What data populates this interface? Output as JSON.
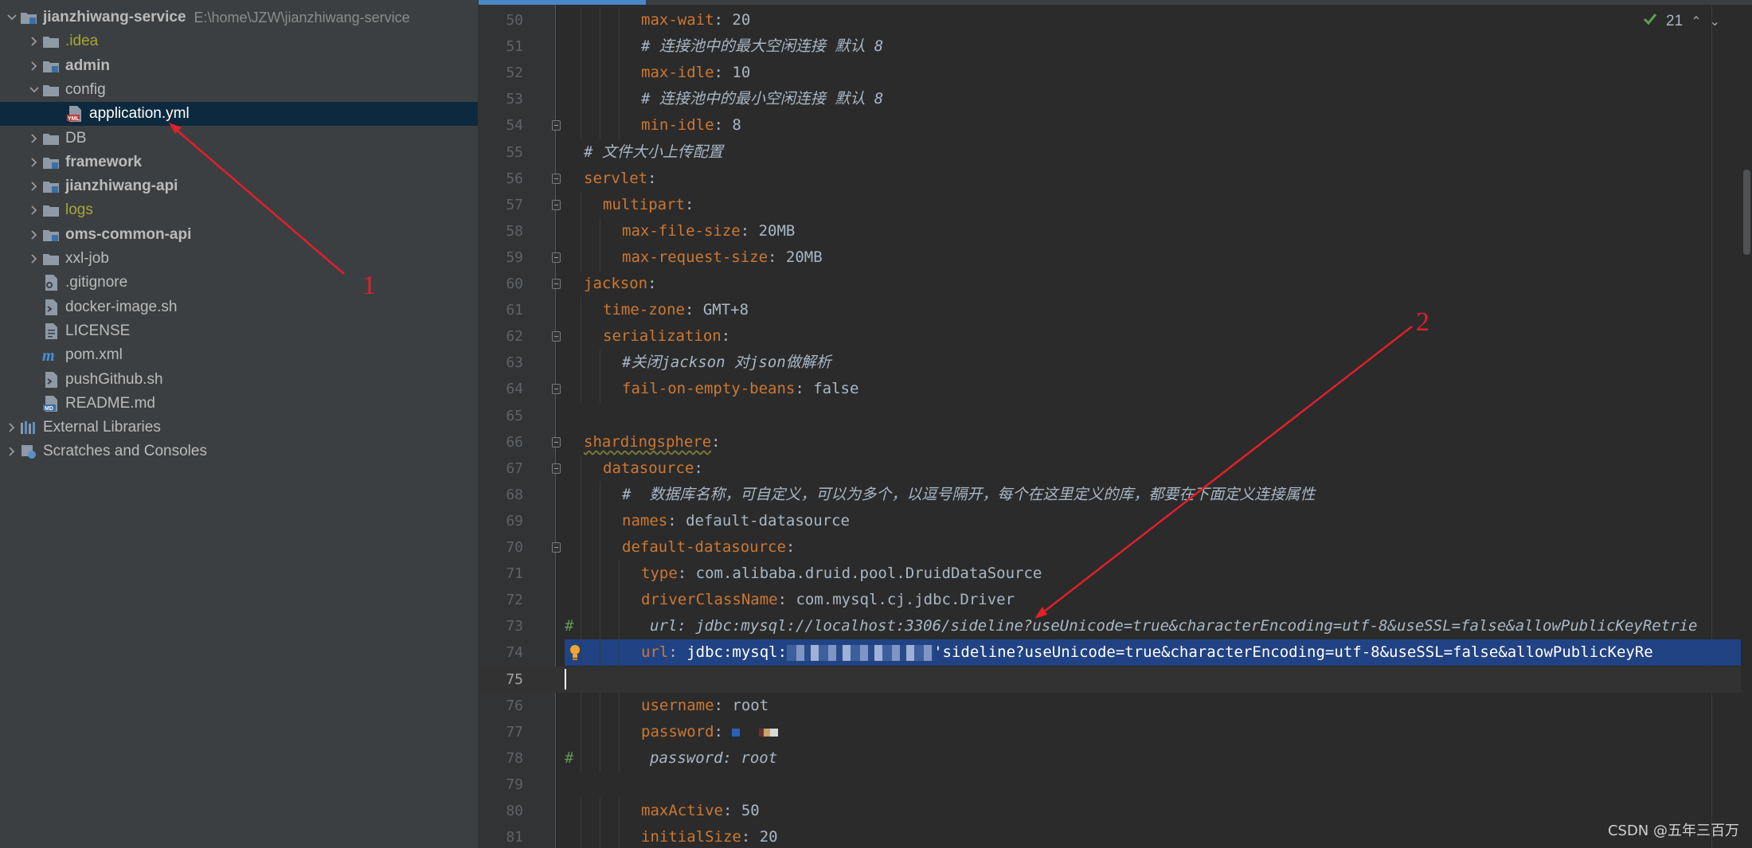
{
  "project_tree": {
    "root": {
      "name": "jianzhiwang-service",
      "path": "E:\\home\\JZW\\jianzhiwang-service"
    },
    "items": [
      {
        "label": ".idea",
        "icon": "folder-icon",
        "style": "yellow",
        "expandable": true
      },
      {
        "label": "admin",
        "icon": "module-folder-icon",
        "style": "bold",
        "expandable": true
      },
      {
        "label": "config",
        "icon": "folder-icon",
        "style": "normal",
        "expandable": true,
        "expanded": true
      },
      {
        "label": "application.yml",
        "icon": "yml-file-icon",
        "style": "normal",
        "expandable": false,
        "selected": true,
        "child": true
      },
      {
        "label": "DB",
        "icon": "folder-icon",
        "style": "normal",
        "expandable": true
      },
      {
        "label": "framework",
        "icon": "module-folder-icon",
        "style": "bold",
        "expandable": true
      },
      {
        "label": "jianzhiwang-api",
        "icon": "module-folder-icon",
        "style": "bold",
        "expandable": true
      },
      {
        "label": "logs",
        "icon": "folder-icon",
        "style": "yellow",
        "expandable": true
      },
      {
        "label": "oms-common-api",
        "icon": "module-folder-icon",
        "style": "bold",
        "expandable": true
      },
      {
        "label": "xxl-job",
        "icon": "folder-icon",
        "style": "normal",
        "expandable": true
      },
      {
        "label": ".gitignore",
        "icon": "gitignore-file-icon",
        "style": "normal",
        "expandable": false
      },
      {
        "label": "docker-image.sh",
        "icon": "shell-file-icon",
        "style": "normal",
        "expandable": false
      },
      {
        "label": "LICENSE",
        "icon": "text-file-icon",
        "style": "normal",
        "expandable": false
      },
      {
        "label": "pom.xml",
        "icon": "maven-file-icon",
        "style": "normal",
        "expandable": false
      },
      {
        "label": "pushGithub.sh",
        "icon": "shell-file-icon",
        "style": "normal",
        "expandable": false
      },
      {
        "label": "README.md",
        "icon": "markdown-file-icon",
        "style": "normal",
        "expandable": false
      }
    ],
    "external_libraries": "External Libraries",
    "scratches": "Scratches and Consoles"
  },
  "editor": {
    "inspection_count": "21",
    "lines": [
      {
        "n": "50",
        "indent": 4,
        "key": "max-wait",
        "value": "20",
        "fold": false
      },
      {
        "n": "51",
        "indent": 4,
        "comment": "# 连接池中的最大空闲连接 默认 8"
      },
      {
        "n": "52",
        "indent": 4,
        "key": "max-idle",
        "value": "10"
      },
      {
        "n": "53",
        "indent": 4,
        "comment": "# 连接池中的最小空闲连接 默认 8"
      },
      {
        "n": "54",
        "indent": 4,
        "key": "min-idle",
        "value": "8",
        "fold": true
      },
      {
        "n": "55",
        "indent": 1,
        "comment": "# 文件大小上传配置"
      },
      {
        "n": "56",
        "indent": 1,
        "key": "servlet",
        "value": "",
        "fold": true
      },
      {
        "n": "57",
        "indent": 2,
        "key": "multipart",
        "value": "",
        "fold": true
      },
      {
        "n": "58",
        "indent": 3,
        "key": "max-file-size",
        "value": "20MB"
      },
      {
        "n": "59",
        "indent": 3,
        "key": "max-request-size",
        "value": "20MB",
        "fold": true
      },
      {
        "n": "60",
        "indent": 1,
        "key": "jackson",
        "value": "",
        "fold": true
      },
      {
        "n": "61",
        "indent": 2,
        "key": "time-zone",
        "value": "GMT+8"
      },
      {
        "n": "62",
        "indent": 2,
        "key": "serialization",
        "value": "",
        "fold": true
      },
      {
        "n": "63",
        "indent": 3,
        "comment": "#关闭jackson 对json做解析"
      },
      {
        "n": "64",
        "indent": 3,
        "key": "fail-on-empty-beans",
        "value": "false",
        "fold": true
      },
      {
        "n": "65",
        "indent": 0,
        "blank": true
      },
      {
        "n": "66",
        "indent": 1,
        "key": "shardingsphere",
        "value": "",
        "fold": true,
        "wavy": true
      },
      {
        "n": "67",
        "indent": 2,
        "key": "datasource",
        "value": "",
        "fold": true
      },
      {
        "n": "68",
        "indent": 3,
        "comment": "#  数据库名称，可自定义，可以为多个，以逗号隔开，每个在这里定义的库，都要在下面定义连接属性"
      },
      {
        "n": "69",
        "indent": 3,
        "key": "names",
        "value": "default-datasource"
      },
      {
        "n": "70",
        "indent": 3,
        "key": "default-datasource",
        "value": "",
        "fold": true
      },
      {
        "n": "71",
        "indent": 4,
        "key": "type",
        "value": "com.alibaba.druid.pool.DruidDataSource"
      },
      {
        "n": "72",
        "indent": 4,
        "key": "driverClassName",
        "value": "com.mysql.cj.jdbc.Driver"
      },
      {
        "n": "73",
        "indent": 4,
        "commented_out": "url: jdbc:mysql://localhost:3306/sideline?useUnicode=true&characterEncoding=utf-8&useSSL=false&allowPublicKeyRetrie"
      },
      {
        "n": "74",
        "indent": 4,
        "key": "url",
        "value_prefix": "jdbc:mysql:",
        "value_suffix": "'sideline?useUnicode=true&characterEncoding=utf-8&useSSL=false&allowPublicKeyRe",
        "selected": true,
        "bulb": true
      },
      {
        "n": "75",
        "indent": 0,
        "blank": true,
        "caret": true
      },
      {
        "n": "76",
        "indent": 4,
        "key": "username",
        "value": "root"
      },
      {
        "n": "77",
        "indent": 4,
        "key": "password",
        "value": "",
        "masked": true
      },
      {
        "n": "78",
        "indent": 4,
        "commented_out": "password: root"
      },
      {
        "n": "79",
        "indent": 0,
        "blank": true
      },
      {
        "n": "80",
        "indent": 4,
        "key": "maxActive",
        "value": "50"
      },
      {
        "n": "81",
        "indent": 4,
        "key": "initialSize",
        "value": "20"
      }
    ]
  },
  "annotations": {
    "label_1": "1",
    "label_2": "2",
    "color": "#e0202a"
  },
  "watermark": "CSDN @五年三百万"
}
